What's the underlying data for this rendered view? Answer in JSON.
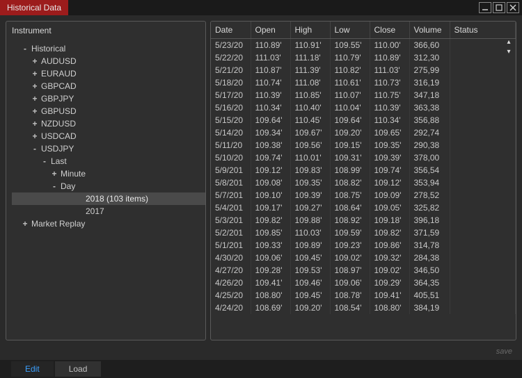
{
  "titlebar": {
    "title": "Historical Data"
  },
  "tree": {
    "header": "Instrument",
    "root": [
      {
        "label": "Historical",
        "exp": "-"
      },
      {
        "label": "Market Replay",
        "exp": "+"
      }
    ],
    "symbols": [
      {
        "label": "AUDUSD",
        "exp": "+"
      },
      {
        "label": "EURAUD",
        "exp": "+"
      },
      {
        "label": "GBPCAD",
        "exp": "+"
      },
      {
        "label": "GBPJPY",
        "exp": "+"
      },
      {
        "label": "GBPUSD",
        "exp": "+"
      },
      {
        "label": "NZDUSD",
        "exp": "+"
      },
      {
        "label": "USDCAD",
        "exp": "+"
      },
      {
        "label": "USDJPY",
        "exp": "-"
      }
    ],
    "usdjpy": {
      "last_label": "Last",
      "last_exp": "-",
      "minute_label": "Minute",
      "minute_exp": "+",
      "day_label": "Day",
      "day_exp": "-",
      "years": [
        {
          "label": "2018 (103 items)",
          "selected": true
        },
        {
          "label": "2017",
          "selected": false
        }
      ]
    }
  },
  "grid": {
    "columns": [
      "Date",
      "Open",
      "High",
      "Low",
      "Close",
      "Volume",
      "Status"
    ],
    "rows": [
      {
        "d": "5/23/20",
        "o": "110.89'",
        "h": "110.91'",
        "l": "109.55'",
        "c": "110.00'",
        "v": "366,60",
        "s": ""
      },
      {
        "d": "5/22/20",
        "o": "111.03'",
        "h": "111.18'",
        "l": "110.79'",
        "c": "110.89'",
        "v": "312,30",
        "s": ""
      },
      {
        "d": "5/21/20",
        "o": "110.87'",
        "h": "111.39'",
        "l": "110.82'",
        "c": "111.03'",
        "v": "275,99",
        "s": ""
      },
      {
        "d": "5/18/20",
        "o": "110.74'",
        "h": "111.08'",
        "l": "110.61'",
        "c": "110.73'",
        "v": "316,19",
        "s": ""
      },
      {
        "d": "5/17/20",
        "o": "110.39'",
        "h": "110.85'",
        "l": "110.07'",
        "c": "110.75'",
        "v": "347,18",
        "s": ""
      },
      {
        "d": "5/16/20",
        "o": "110.34'",
        "h": "110.40'",
        "l": "110.04'",
        "c": "110.39'",
        "v": "363,38",
        "s": ""
      },
      {
        "d": "5/15/20",
        "o": "109.64'",
        "h": "110.45'",
        "l": "109.64'",
        "c": "110.34'",
        "v": "356,88",
        "s": ""
      },
      {
        "d": "5/14/20",
        "o": "109.34'",
        "h": "109.67'",
        "l": "109.20'",
        "c": "109.65'",
        "v": "292,74",
        "s": ""
      },
      {
        "d": "5/11/20",
        "o": "109.38'",
        "h": "109.56'",
        "l": "109.15'",
        "c": "109.35'",
        "v": "290,38",
        "s": ""
      },
      {
        "d": "5/10/20",
        "o": "109.74'",
        "h": "110.01'",
        "l": "109.31'",
        "c": "109.39'",
        "v": "378,00",
        "s": ""
      },
      {
        "d": "5/9/201",
        "o": "109.12'",
        "h": "109.83'",
        "l": "108.99'",
        "c": "109.74'",
        "v": "356,54",
        "s": ""
      },
      {
        "d": "5/8/201",
        "o": "109.08'",
        "h": "109.35'",
        "l": "108.82'",
        "c": "109.12'",
        "v": "353,94",
        "s": ""
      },
      {
        "d": "5/7/201",
        "o": "109.10'",
        "h": "109.39'",
        "l": "108.75'",
        "c": "109.09'",
        "v": "278,52",
        "s": ""
      },
      {
        "d": "5/4/201",
        "o": "109.17'",
        "h": "109.27'",
        "l": "108.64'",
        "c": "109.05'",
        "v": "325,82",
        "s": ""
      },
      {
        "d": "5/3/201",
        "o": "109.82'",
        "h": "109.88'",
        "l": "108.92'",
        "c": "109.18'",
        "v": "396,18",
        "s": ""
      },
      {
        "d": "5/2/201",
        "o": "109.85'",
        "h": "110.03'",
        "l": "109.59'",
        "c": "109.82'",
        "v": "371,59",
        "s": ""
      },
      {
        "d": "5/1/201",
        "o": "109.33'",
        "h": "109.89'",
        "l": "109.23'",
        "c": "109.86'",
        "v": "314,78",
        "s": ""
      },
      {
        "d": "4/30/20",
        "o": "109.06'",
        "h": "109.45'",
        "l": "109.02'",
        "c": "109.32'",
        "v": "284,38",
        "s": ""
      },
      {
        "d": "4/27/20",
        "o": "109.28'",
        "h": "109.53'",
        "l": "108.97'",
        "c": "109.02'",
        "v": "346,50",
        "s": ""
      },
      {
        "d": "4/26/20",
        "o": "109.41'",
        "h": "109.46'",
        "l": "109.06'",
        "c": "109.29'",
        "v": "364,35",
        "s": ""
      },
      {
        "d": "4/25/20",
        "o": "108.80'",
        "h": "109.45'",
        "l": "108.78'",
        "c": "109.41'",
        "v": "405,51",
        "s": ""
      },
      {
        "d": "4/24/20",
        "o": "108.69'",
        "h": "109.20'",
        "l": "108.54'",
        "c": "108.80'",
        "v": "384,19",
        "s": ""
      }
    ]
  },
  "footer": {
    "save": "save"
  },
  "tabs": {
    "edit": "Edit",
    "load": "Load"
  }
}
